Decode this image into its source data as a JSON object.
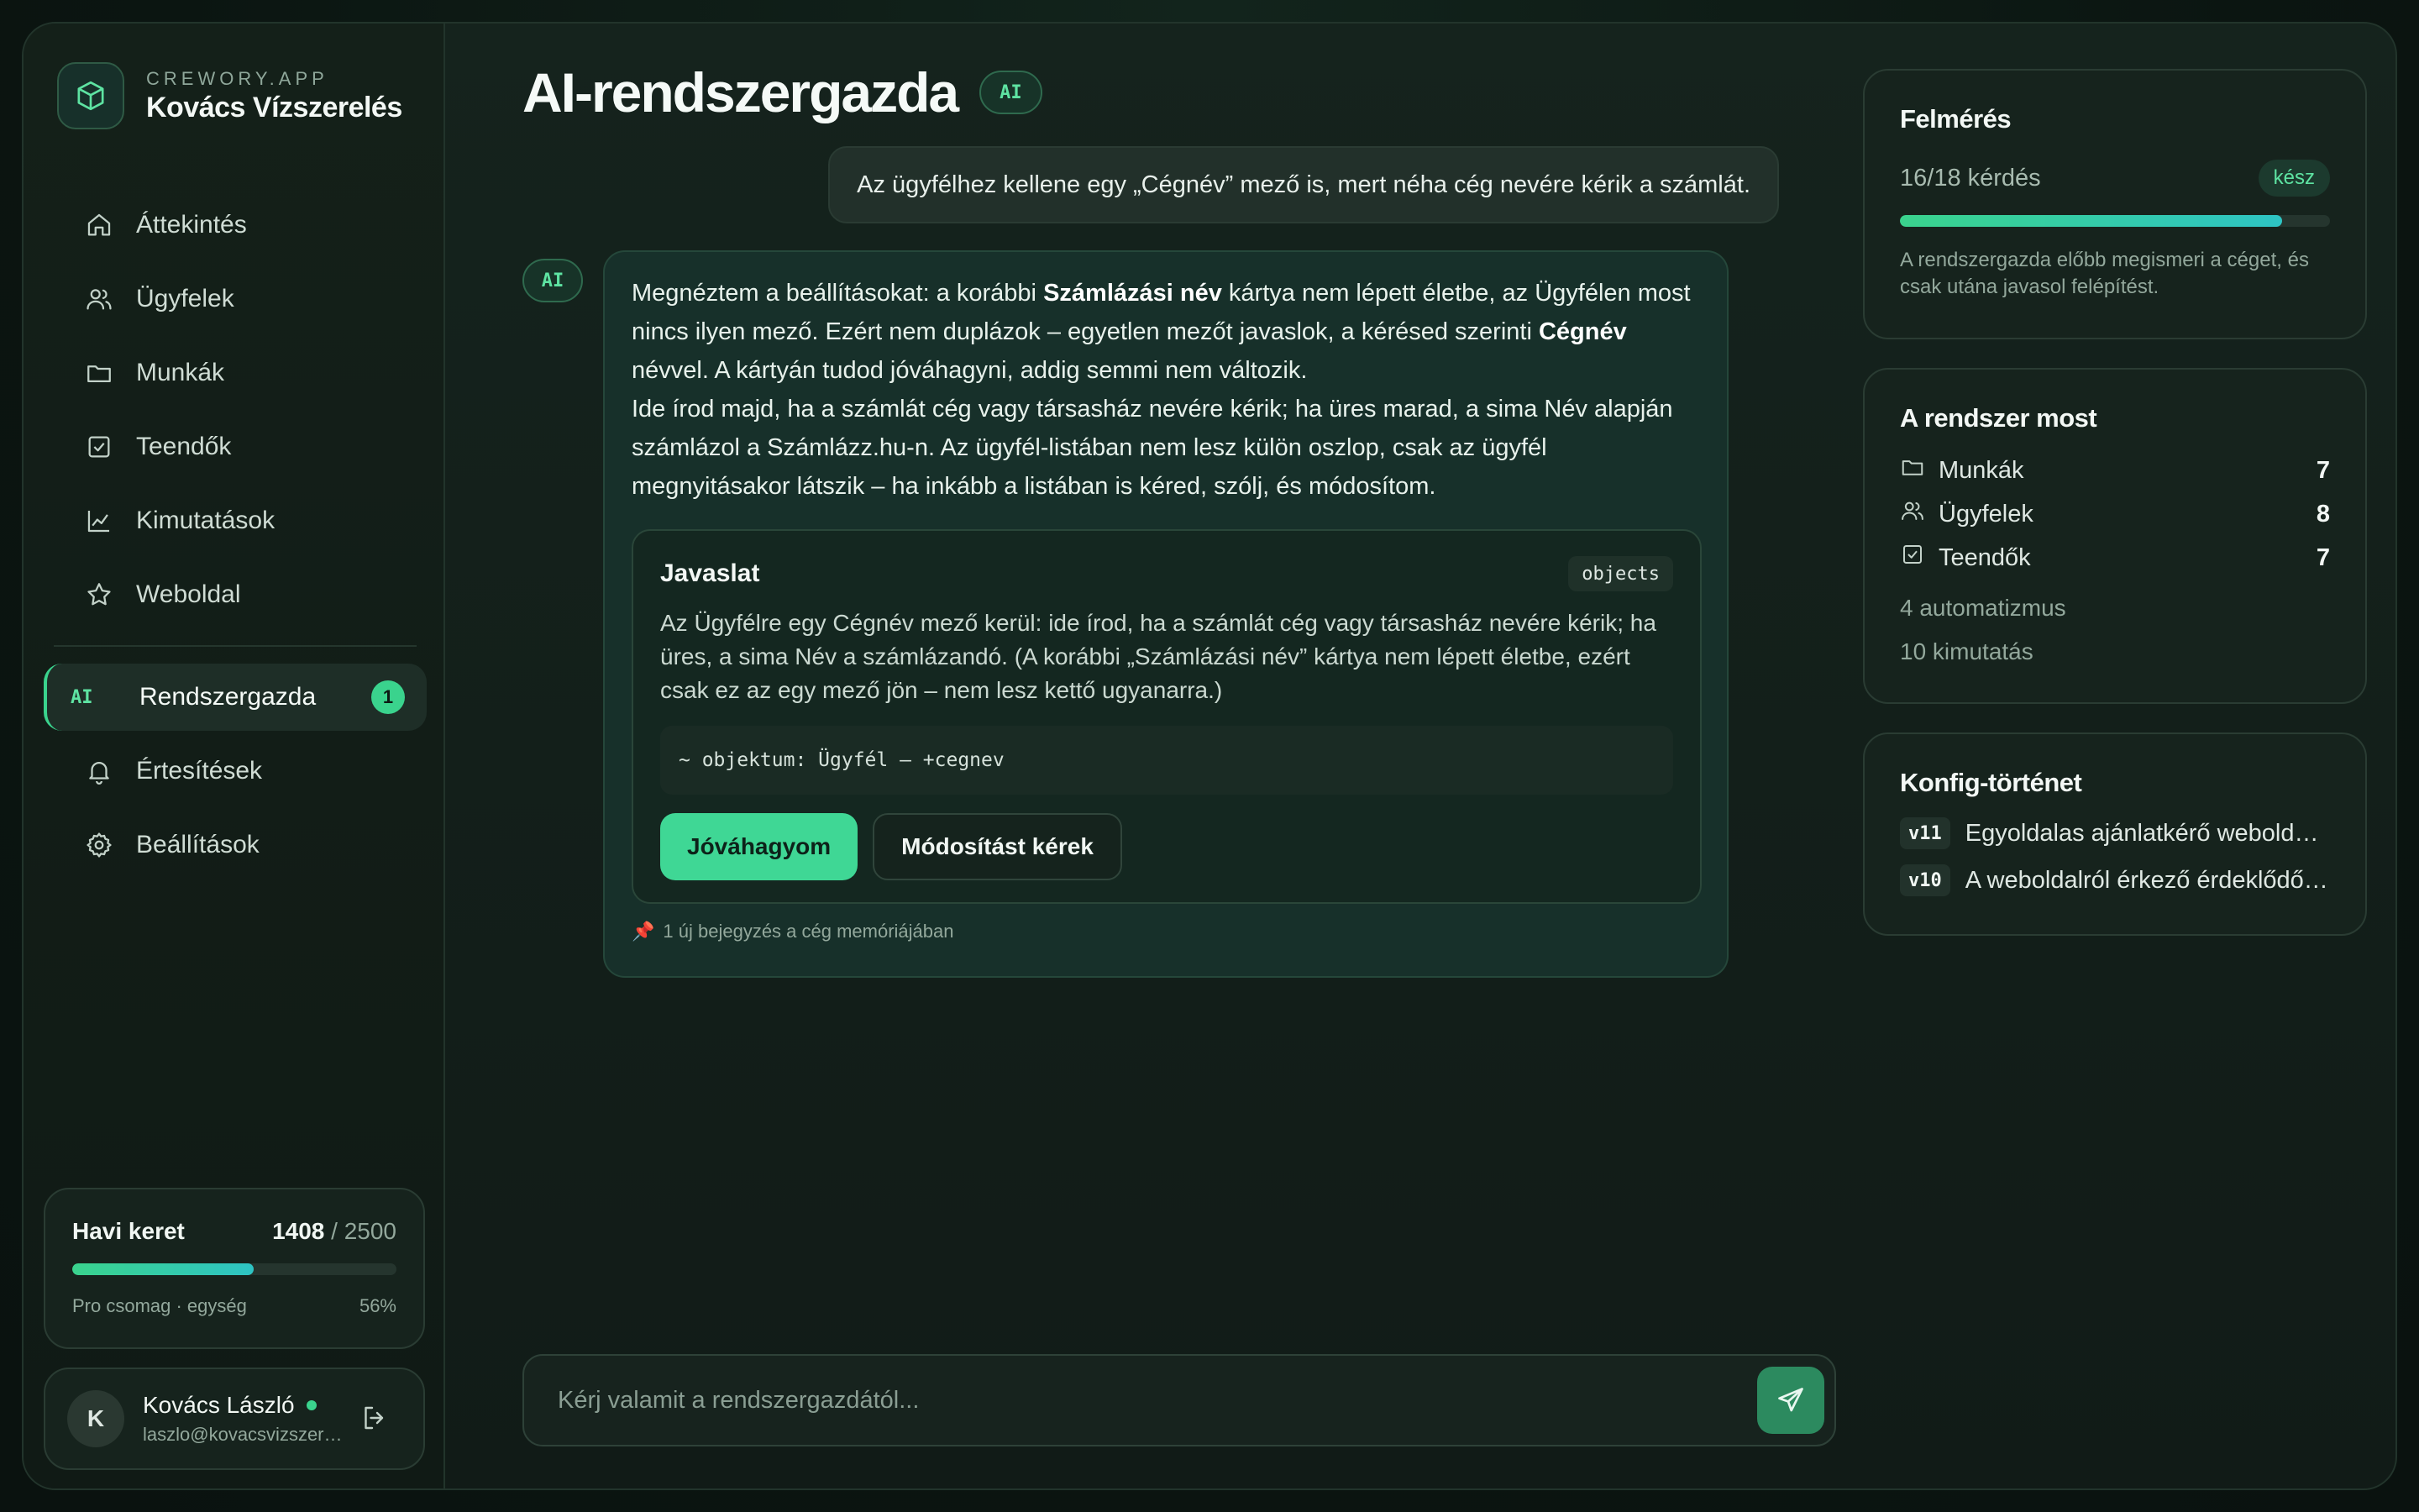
{
  "brand": {
    "app": "CREWORY.APP",
    "name": "Kovács Vízszerelés"
  },
  "nav": {
    "items": [
      {
        "label": "Áttekintés",
        "icon": "home-icon"
      },
      {
        "label": "Ügyfelek",
        "icon": "users-icon"
      },
      {
        "label": "Munkák",
        "icon": "folder-icon"
      },
      {
        "label": "Teendők",
        "icon": "checkbox-icon"
      },
      {
        "label": "Kimutatások",
        "icon": "chart-icon"
      },
      {
        "label": "Weboldal",
        "icon": "star-icon"
      }
    ],
    "active": {
      "mark": "AI",
      "label": "Rendszergazda",
      "badge": "1"
    },
    "secondary": [
      {
        "label": "Értesítések",
        "icon": "bell-icon"
      },
      {
        "label": "Beállítások",
        "icon": "gear-icon"
      }
    ]
  },
  "quota": {
    "title": "Havi keret",
    "used": "1408",
    "total": "/ 2500",
    "plan": "Pro csomag · egység",
    "percent_label": "56%",
    "fraction": 0.56
  },
  "user": {
    "initial": "K",
    "name": "Kovács László",
    "email": "laszlo@kovacsvizszerelés.hu"
  },
  "main": {
    "title": "AI-rendszergazda",
    "title_tag": "AI",
    "user_message": "Az ügyfélhez kellene egy „Cégnév” mező is, mert néha cég nevére kérik a számlát.",
    "ai_avatar": "AI",
    "ai_message": {
      "p1_a": "Megnéztem a beállításokat: a korábbi ",
      "p1_b": "Számlázási név",
      "p1_c": " kártya nem lépett életbe, az Ügyfélen most nincs ilyen mező. Ezért nem duplázok – egyetlen mezőt javaslok, a kérésed szerinti ",
      "p1_d": "Cégnév",
      "p1_e": " névvel. A kártyán tudod jóváhagyni, addig semmi nem változik.",
      "p2": "Ide írod majd, ha a számlát cég vagy társasház nevére kérik; ha üres marad, a sima Név alapján számlázol a Számlázz.hu-n. Az ügyfél-listában nem lesz külön oszlop, csak az ügyfél megnyitásakor látszik – ha inkább a listában is kéred, szólj, és módosítom."
    },
    "proposal": {
      "title": "Javaslat",
      "tag": "objects",
      "text": "Az Ügyfélre egy Cégnév mező kerül: ide írod, ha a számlát cég vagy társasház nevére kérik; ha üres, a sima Név a számlázandó. (A korábbi „Számlázási név” kártya nem lépett életbe, ezért csak ez az egy mező jön – nem lesz kettő ugyanarra.)",
      "code": "~ objektum: Ügyfél — +cegnev",
      "approve_label": "Jóváhagyom",
      "modify_label": "Módosítást kérek"
    },
    "memory_note": "1 új bejegyzés a cég memóriájában",
    "composer": {
      "placeholder": "Kérj valamit a rendszergazdától..."
    }
  },
  "survey": {
    "title": "Felmérés",
    "count": "16/18 kérdés",
    "status": "kész",
    "fraction": 0.889,
    "note": "A rendszergazda előbb megismeri a céget, és csak utána javasol felépítést."
  },
  "system": {
    "title": "A rendszer most",
    "rows": [
      {
        "label": "Munkák",
        "value": "7",
        "icon": "folder-icon"
      },
      {
        "label": "Ügyfelek",
        "value": "8",
        "icon": "users-icon"
      },
      {
        "label": "Teendők",
        "value": "7",
        "icon": "checkbox-icon"
      }
    ],
    "automations": "4 automatizmus",
    "reports": "10 kimutatás"
  },
  "history": {
    "title": "Konfig-történet",
    "rows": [
      {
        "version": "v11",
        "text": "Egyoldalas ajánlatkérő weboldal..."
      },
      {
        "version": "v10",
        "text": "A weboldalról érkező érdeklődők..."
      }
    ]
  },
  "colors": {
    "accent": "#3ad38d",
    "background": "#111b17",
    "badge_pin": "#e35a6e"
  }
}
